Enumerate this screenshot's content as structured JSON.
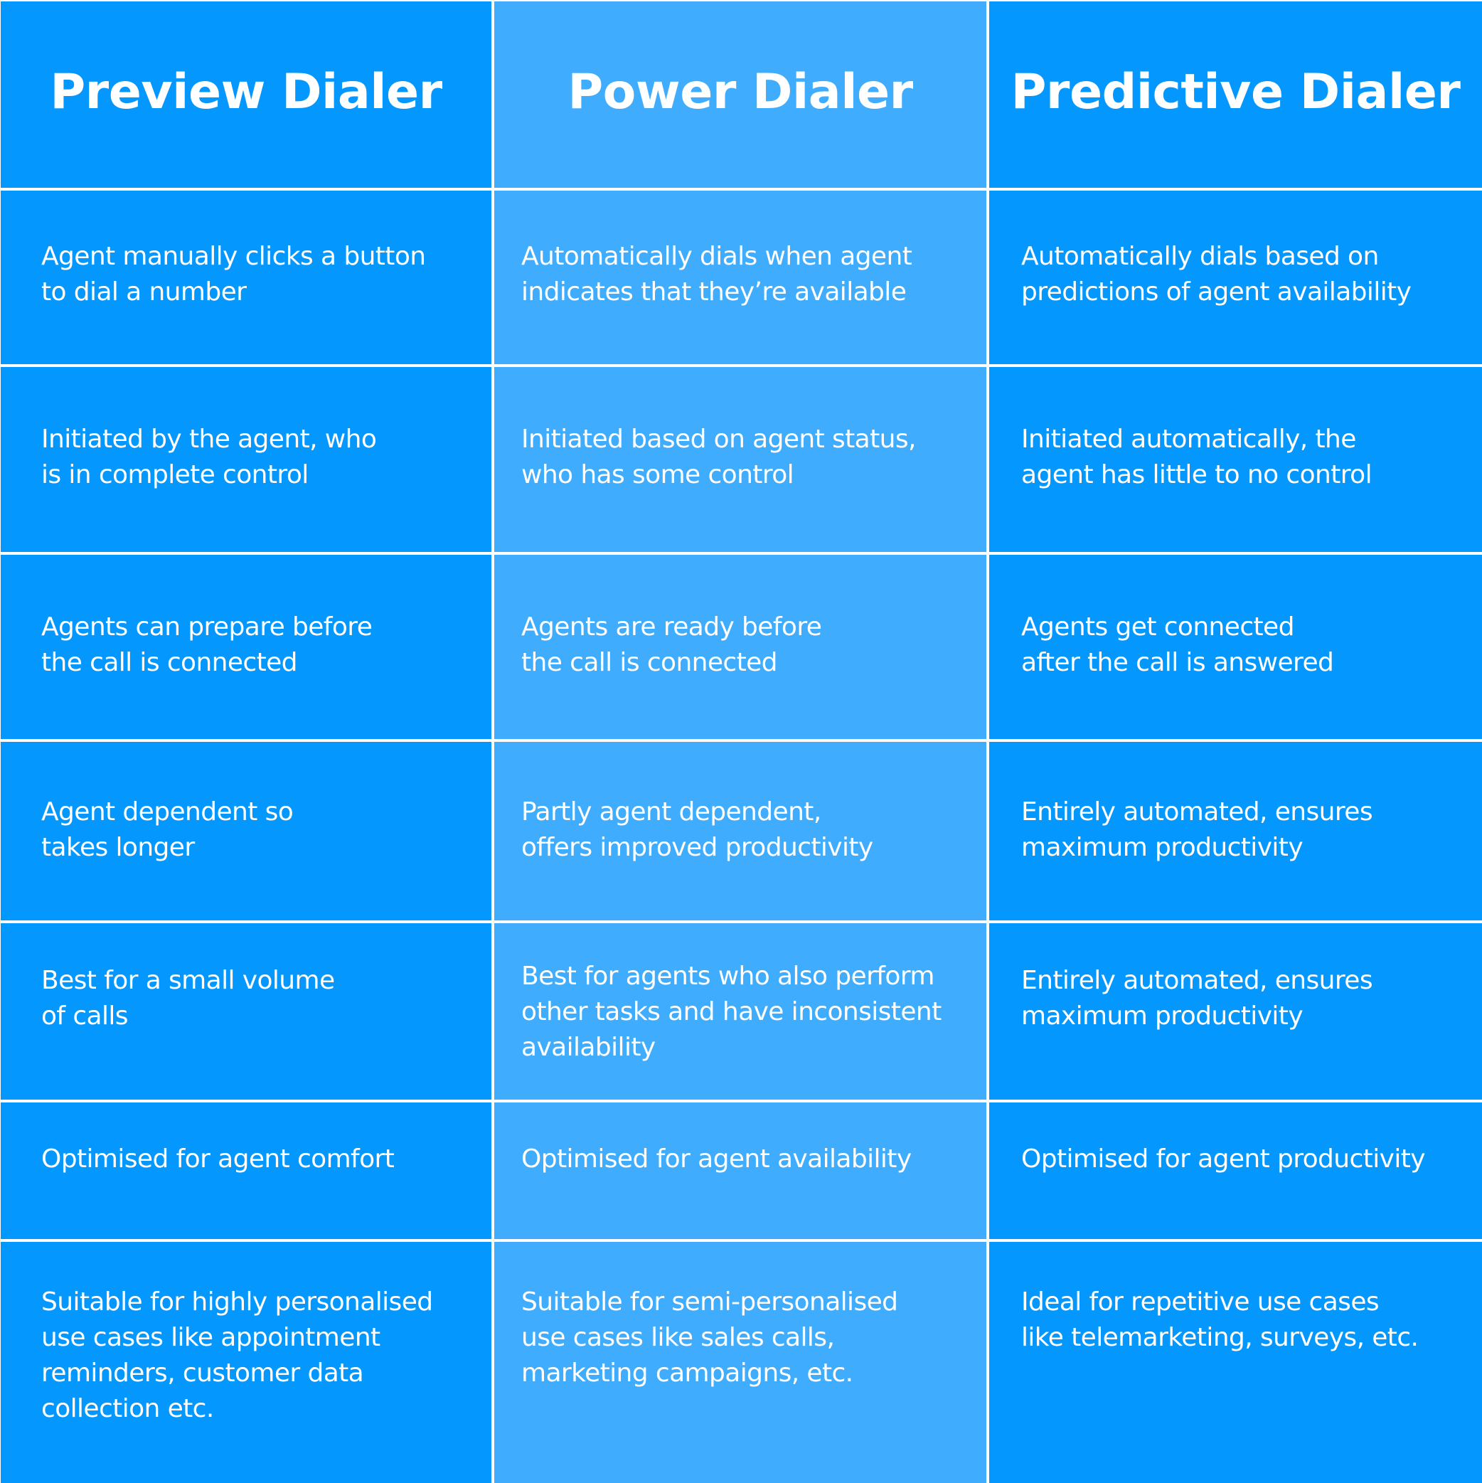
{
  "colors": {
    "dark_column": "#0497FD",
    "light_column": "#3FACFD",
    "grid_lines": "#FFFFFF",
    "text": "#FFFFFF"
  },
  "table": {
    "headers": [
      "Preview Dialer",
      "Power Dialer",
      "Predictive Dialer"
    ],
    "rows": [
      [
        "Agent manually clicks a button\nto dial a number",
        "Automatically dials when agent\nindicates that they’re available",
        "Automatically dials based on\npredictions of agent availability"
      ],
      [
        "Initiated by the agent, who\nis in complete control",
        "Initiated based on agent status,\nwho has some control",
        "Initiated automatically, the\nagent has little to no control"
      ],
      [
        "Agents can prepare before\nthe call is connected",
        "Agents are ready before\nthe call is connected",
        "Agents get connected\nafter the call is answered"
      ],
      [
        "Agent dependent so\ntakes longer",
        "Partly agent dependent,\noffers improved productivity",
        "Entirely automated, ensures\nmaximum productivity"
      ],
      [
        "Best for a small volume\nof calls",
        "Best for agents who also perform\nother tasks and have inconsistent\navailability",
        "Entirely automated, ensures\nmaximum productivity"
      ],
      [
        "Optimised for agent comfort",
        "Optimised for agent availability",
        "Optimised for agent productivity"
      ],
      [
        "Suitable for highly personalised\nuse cases like appointment\nreminders, customer data\ncollection etc.",
        "Suitable for semi-personalised\nuse cases like sales calls,\nmarketing campaigns, etc.",
        "Ideal for repetitive use cases\nlike telemarketing, surveys, etc."
      ]
    ]
  }
}
